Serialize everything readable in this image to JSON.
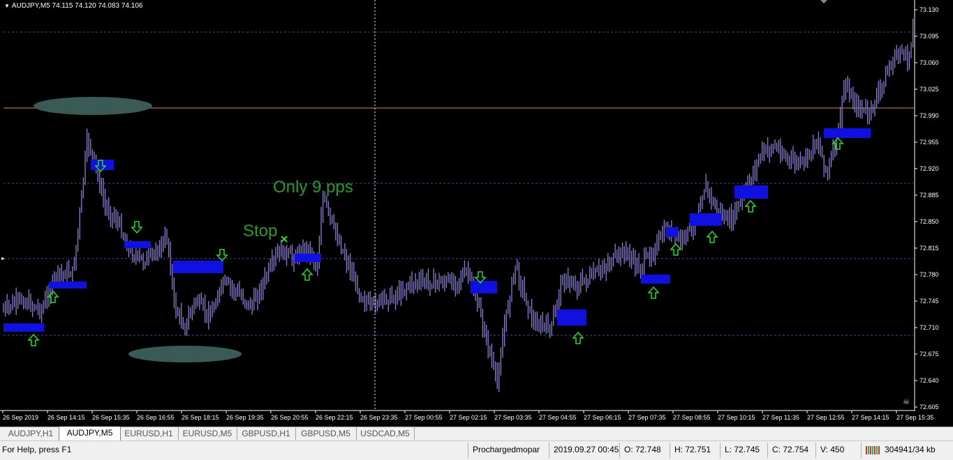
{
  "chart": {
    "symbol_title": "AUDJPY,M5  74.115 74.120 74.083 74.106",
    "price_axis": [
      "73.130",
      "73.095",
      "73.060",
      "73.025",
      "72.990",
      "72.955",
      "72.920",
      "72.885",
      "72.850",
      "72.815",
      "72.780",
      "72.745",
      "72.710",
      "72.675",
      "72.640",
      "72.605"
    ],
    "time_axis": [
      "26 Sep 2019",
      "26 Sep 14:15",
      "26 Sep 15:35",
      "26 Sep 16:55",
      "26 Sep 18:15",
      "26 Sep 19:35",
      "26 Sep 20:55",
      "26 Sep 22:15",
      "26 Sep 23:35",
      "27 Sep 00:55",
      "27 Sep 02:15",
      "27 Sep 03:35",
      "27 Sep 04:55",
      "27 Sep 06:15",
      "27 Sep 07:35",
      "27 Sep 08:55",
      "27 Sep 10:15",
      "27 Sep 11:35",
      "27 Sep 12:55",
      "27 Sep 14:15",
      "27 Sep 15:35"
    ],
    "annotations": {
      "only_pips": "Only 9 pps",
      "stop": "Stop"
    },
    "colors": {
      "background": "#000000",
      "candles": "#8a7fd4",
      "zones": "#1010e0",
      "arrows": "#22e022",
      "annotation_text": "#2a9a2a",
      "level_line": "#c89060",
      "grid_line": "#3048c0",
      "ellipse": "#3a5a56"
    },
    "arrows": [
      {
        "dir": "up"
      },
      {
        "dir": "up"
      },
      {
        "dir": "down"
      },
      {
        "dir": "down"
      },
      {
        "dir": "down"
      },
      {
        "dir": "up"
      },
      {
        "dir": "down"
      },
      {
        "dir": "up"
      },
      {
        "dir": "up"
      },
      {
        "dir": "up"
      },
      {
        "dir": "up"
      },
      {
        "dir": "up"
      },
      {
        "dir": "up"
      }
    ]
  },
  "tabs": [
    {
      "label": "AUDJPY,H1",
      "active": false
    },
    {
      "label": "AUDJPY,M5",
      "active": true
    },
    {
      "label": "EURUSD,H1",
      "active": false
    },
    {
      "label": "EURUSD,M5",
      "active": false
    },
    {
      "label": "GBPUSD,H1",
      "active": false
    },
    {
      "label": "GBPUSD,M5",
      "active": false
    },
    {
      "label": "USDCAD,M5",
      "active": false
    }
  ],
  "status": {
    "help": "For Help, press F1",
    "profile": "Prochargedmopar",
    "datetime": "2019.09.27 00:45",
    "open": "O: 72.748",
    "high": "H: 72.751",
    "low": "L: 72.745",
    "close": "C: 72.754",
    "volume": "V: 450",
    "traffic": "304941/34 kb"
  }
}
